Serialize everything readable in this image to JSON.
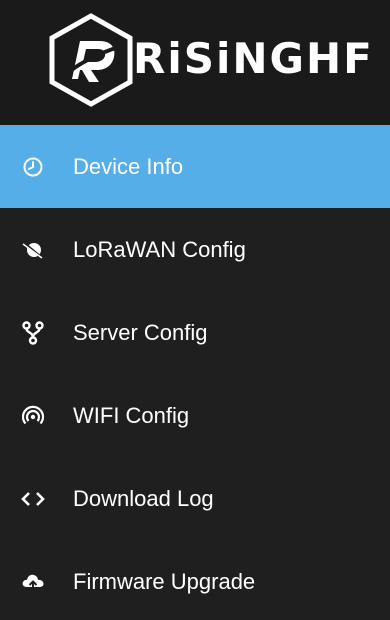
{
  "brand": {
    "name": "RiSiNGHF"
  },
  "colors": {
    "sidebar_bg": "#1f1f1f",
    "active_bg": "#55aee8",
    "text": "#ffffff"
  },
  "menu": {
    "items": [
      {
        "label": "Device Info",
        "icon": "clock-icon",
        "active": true
      },
      {
        "label": "LoRaWAN Config",
        "icon": "satellite-icon",
        "active": false
      },
      {
        "label": "Server Config",
        "icon": "fork-icon",
        "active": false
      },
      {
        "label": "WIFI Config",
        "icon": "wifi-signal-icon",
        "active": false
      },
      {
        "label": "Download Log",
        "icon": "code-icon",
        "active": false
      },
      {
        "label": "Firmware Upgrade",
        "icon": "cloud-upload-icon",
        "active": false
      }
    ]
  }
}
